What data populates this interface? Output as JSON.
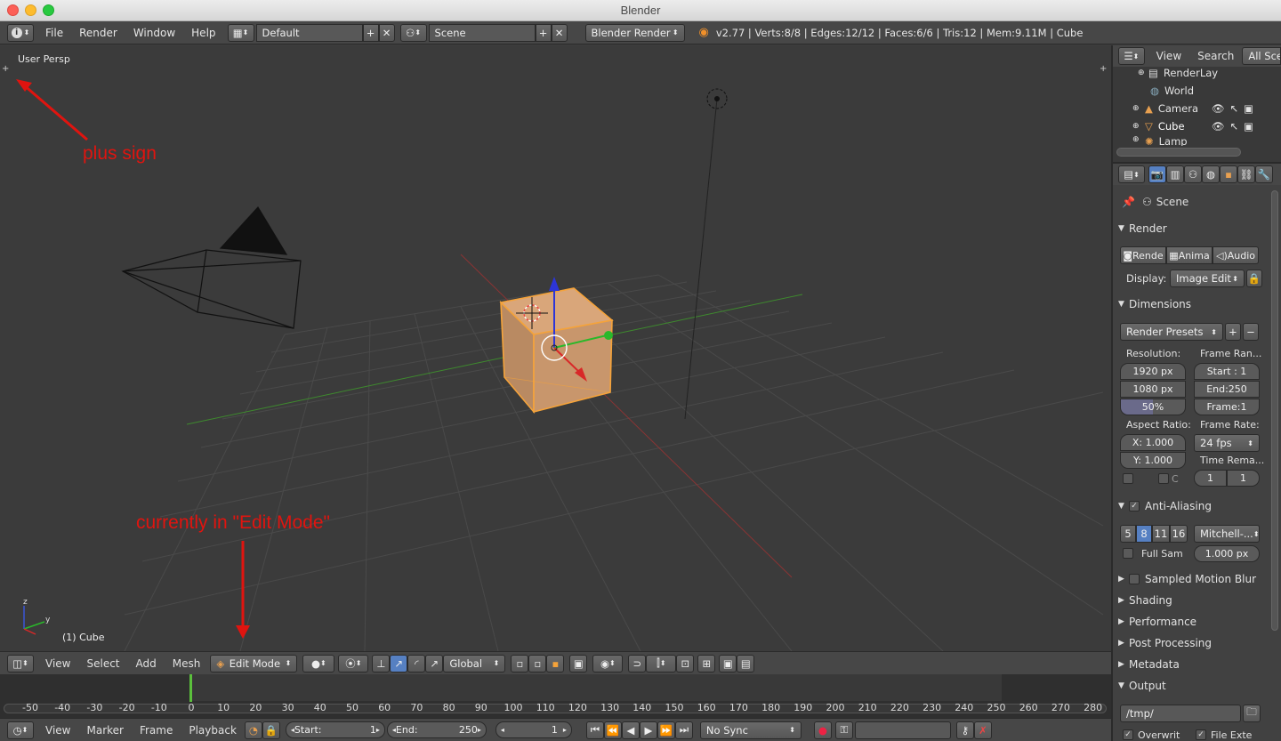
{
  "window": {
    "title": "Blender"
  },
  "topbar": {
    "menus": [
      "File",
      "Render",
      "Window",
      "Help"
    ],
    "screen_layout": "Default",
    "scene": "Scene",
    "render_engine": "Blender Render",
    "stats": "v2.77 | Verts:8/8 | Edges:12/12 | Faces:6/6 | Tris:12 | Mem:9.11M | Cube"
  },
  "viewport": {
    "view_label": "User Persp",
    "object_label": "(1) Cube",
    "annotations": {
      "plus_sign": "plus sign",
      "edit_mode": "currently in \"Edit Mode\""
    }
  },
  "header3d": {
    "menus": [
      "View",
      "Select",
      "Add",
      "Mesh"
    ],
    "mode": "Edit Mode",
    "orientation": "Global"
  },
  "timeline": {
    "ticks": [
      "-50",
      "-40",
      "-30",
      "-20",
      "-10",
      "0",
      "10",
      "20",
      "30",
      "40",
      "50",
      "60",
      "70",
      "80",
      "90",
      "100",
      "110",
      "120",
      "130",
      "140",
      "150",
      "160",
      "170",
      "180",
      "190",
      "200",
      "210",
      "220",
      "230",
      "240",
      "250",
      "260",
      "270",
      "280"
    ],
    "current_frame_marker": 0
  },
  "timeline_header": {
    "menus": [
      "View",
      "Marker",
      "Frame",
      "Playback"
    ],
    "start_label": "Start:",
    "start_value": "1",
    "end_label": "End:",
    "end_value": "250",
    "current_frame": "1",
    "sync": "No Sync"
  },
  "outliner": {
    "menus": [
      "View",
      "Search"
    ],
    "filter": "All Scen",
    "items": [
      "RenderLay",
      "World",
      "Camera",
      "Cube",
      "Lamp"
    ]
  },
  "properties": {
    "context": "Scene",
    "render": {
      "title": "Render",
      "buttons": [
        "Rende",
        "Anima",
        "Audio"
      ],
      "display_label": "Display:",
      "display_value": "Image Edit"
    },
    "dimensions": {
      "title": "Dimensions",
      "presets": "Render Presets",
      "resolution_label": "Resolution:",
      "frame_range_label": "Frame Ran...",
      "res_x": "1920 px",
      "res_y": "1080 px",
      "res_pct": "50%",
      "start": "Start : 1",
      "end": "End:250",
      "frame": "Frame:1",
      "aspect_label": "Aspect Ratio:",
      "frame_rate_label": "Frame Rate:",
      "aspect_x": "X: 1.000",
      "aspect_y": "Y: 1.000",
      "fps": "24 fps",
      "time_remap_label": "Time Rema...",
      "remap_old": "1",
      "remap_new": "1",
      "crop_label": "C"
    },
    "anti_aliasing": {
      "title": "Anti-Aliasing",
      "samples": [
        "5",
        "8",
        "11",
        "16"
      ],
      "filter": "Mitchell-...",
      "full_sample": "Full Sam",
      "size": "1.000 px"
    },
    "collapsed_panels": [
      "Sampled Motion Blur",
      "Shading",
      "Performance",
      "Post Processing",
      "Metadata"
    ],
    "output": {
      "title": "Output",
      "path": "/tmp/",
      "overwrite": "Overwrit",
      "file_ext": "File Exte"
    }
  },
  "colors": {
    "accent_blue": "#5680c2",
    "selection_orange": "#f5a33a",
    "annotation_red": "#e0140f"
  }
}
